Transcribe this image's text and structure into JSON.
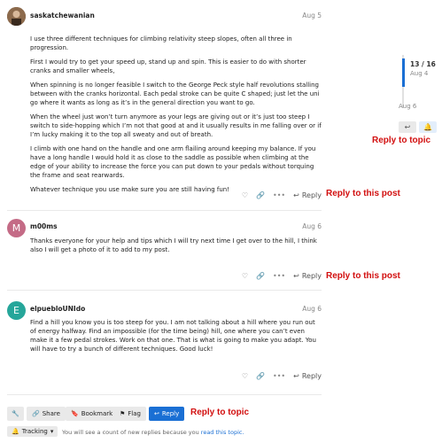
{
  "posts": [
    {
      "username": "saskatchewanian",
      "date": "Aug 5",
      "avatar_color": "#7a5a3a",
      "paragraphs": [
        "I use three different techniques for climbing relativity steep slopes, often all three in progression.",
        "First I would try to get your speed up, stand up and spin. This is easier to do with shorter cranks and smaller wheels,",
        "When spinning is no longer feasible I switch to the George Peck style half revolutions stalling between with the cranks horizontal. Each pedal stroke can be quite C shaped; just let the uni go where it wants as long as it’s in the general direction you want to go.",
        "When the wheel just won’t turn anymore as your legs are giving out or it’s just too steep I switch to side-hopping which I’m not that good at and it usually results in me falling over or if I’m lucky making it to the top all sweaty and out of breath.",
        "I climb with one hand on the handle and one arm flailing around keeping my balance. If you have a long handle I would hold it as close to the saddle as possible when climbing at the edge of your ability to increase the force you can put down to your pedals without torquing the frame and seat rearwards.",
        "Whatever technique you use make sure you are still having fun!"
      ],
      "reply_label": "Reply"
    },
    {
      "username": "m00ms",
      "date": "Aug 6",
      "avatar_letter": "M",
      "avatar_color": "#c46b86",
      "paragraphs": [
        "Thanks everyone for your help and tips which I will try next time I get over to the hill, I think also I will get a photo of it to add to my post."
      ],
      "reply_label": "Reply"
    },
    {
      "username": "elpuebloUNIdo",
      "date": "Aug 6",
      "avatar_letter": "E",
      "avatar_color": "#26a69a",
      "paragraphs": [
        "Find a hill you know you is too steep for you. I am not talking about a hill where you run out of energy halfway. Find an impossible (for the time being) hill, one where you can’t even make it a few pedal strokes. Work on that one. That is what is going to make you adapt. You will have to try a bunch of different techniques. Good luck!"
      ],
      "reply_label": "Reply"
    }
  ],
  "timeline": {
    "count": "13 / 16",
    "date": "Aug 4",
    "bottom_date": "Aug 6",
    "accent": "#1a6fd4"
  },
  "annotations": {
    "reply_to_topic_side": "Reply to topic",
    "reply_to_post_1": "Reply to this post",
    "reply_to_post_2": "Reply to this post",
    "reply_to_topic_footer": "Reply to topic"
  },
  "footer": {
    "share": "Share",
    "bookmark": "Bookmark",
    "flag": "Flag",
    "reply": "Reply",
    "tracking": "Tracking",
    "tracking_note": "You will see a count of new replies because you ",
    "tracking_link": "read this topic."
  }
}
